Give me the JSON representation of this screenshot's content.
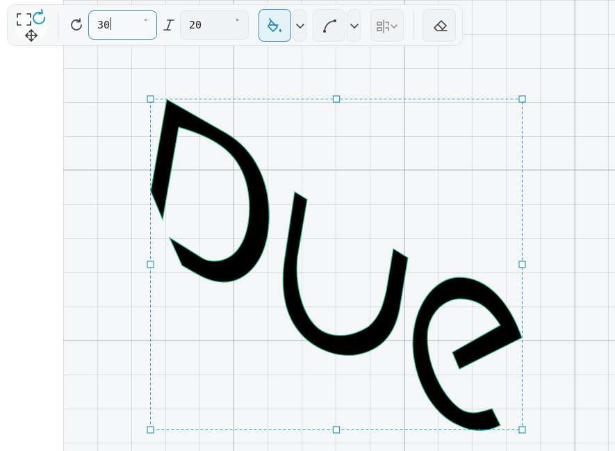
{
  "toolbar": {
    "rotation_value": "30",
    "rotation_unit": "°",
    "skew_value": "20",
    "skew_unit": "°"
  },
  "canvas": {
    "shape_text": "Due",
    "shape_fill": "#000000",
    "shape_outline": "#1fbf8f",
    "selection_color": "#1a9bc9"
  },
  "icons": [
    "transform-icon",
    "rotate-icon",
    "italic-icon",
    "fill-bucket-icon",
    "chevron-down-icon",
    "curve-icon",
    "align-icon",
    "eraser-icon"
  ]
}
